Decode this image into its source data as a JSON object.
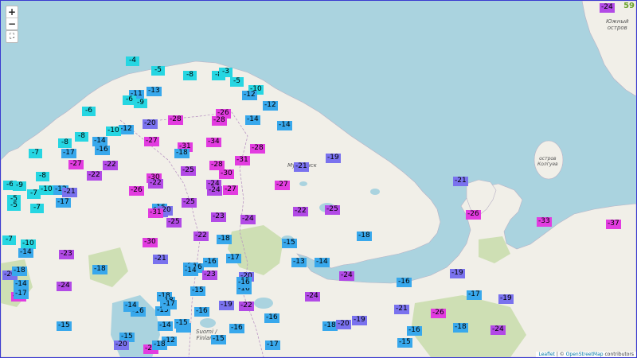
{
  "map": {
    "controls": {
      "zoom_in": "+",
      "zoom_out": "−",
      "fullscreen": "⛶"
    },
    "count": "59",
    "attribution": {
      "leaflet": "Leaflet",
      "separator": " | © ",
      "osm": "OpenStreetMap",
      "suffix": " contributors"
    },
    "place_labels": [
      {
        "id": "yuzhny",
        "text": "Южный\nостров"
      },
      {
        "id": "kolguev",
        "text": "остров\nКолгуев"
      },
      {
        "id": "murmansk",
        "text": "Мурманск"
      },
      {
        "id": "finland",
        "text": "Suomi /\nFinland"
      }
    ],
    "colors": {
      "cyan": "#26d6e2",
      "blue": "#38a8ec",
      "indigo": "#7a72ee",
      "violet": "#b24ae6",
      "magenta": "#e23ce0",
      "sea": "#aad3df",
      "land": "#f1efe8",
      "forest": "#c8dcaa"
    },
    "temps": [
      "-24",
      "-4",
      "-5",
      "-8",
      "-8",
      "-3",
      "-5",
      "-10",
      "-11",
      "-6",
      "-9",
      "-13",
      "-12",
      "-12",
      "-6",
      "-20",
      "-28",
      "-26",
      "-28",
      "-14",
      "-14",
      "-12",
      "-10",
      "-8",
      "-14",
      "-27",
      "-31",
      "-34",
      "-18",
      "-28",
      "-7",
      "-17",
      "-16",
      "-8",
      "-27",
      "-22",
      "-22",
      "-31",
      "-28",
      "-21",
      "-19",
      "-8",
      "-30",
      "-22",
      "-25",
      "-30",
      "-6",
      "-9",
      "-10",
      "-12",
      "-21",
      "-26",
      "-24",
      "-24",
      "-27",
      "-27",
      "-21",
      "-17",
      "-5",
      "-7",
      "-5",
      "-7",
      "-16",
      "-19",
      "-20",
      "-31",
      "-25",
      "-25",
      "-23",
      "-24",
      "-22",
      "-22",
      "-25",
      "-26",
      "-33",
      "-37",
      "-7",
      "-10",
      "-30",
      "-18",
      "-15",
      "-18",
      "-14",
      "-23",
      "-21",
      "-16",
      "-17",
      "-13",
      "-14",
      "-20",
      "-18",
      "-24",
      "-18",
      "-16",
      "-16",
      "-14",
      "-14",
      "-23",
      "-20",
      "-24",
      "-16",
      "-15",
      "-26",
      "-15",
      "-16",
      "-19",
      "-17",
      "-16",
      "-15",
      "-16",
      "-18",
      "-18",
      "-19",
      "-17",
      "-14",
      "-15",
      "-19",
      "-24",
      "-16",
      "-22",
      "-21",
      "-26",
      "-17",
      "-15",
      "-15",
      "-14",
      "-16",
      "-15",
      "-16",
      "-16",
      "-18",
      "-20",
      "-19",
      "-16",
      "-18",
      "-24",
      "-20",
      "-27",
      "-12",
      "-18",
      "-15",
      "-17",
      "-15"
    ]
  }
}
